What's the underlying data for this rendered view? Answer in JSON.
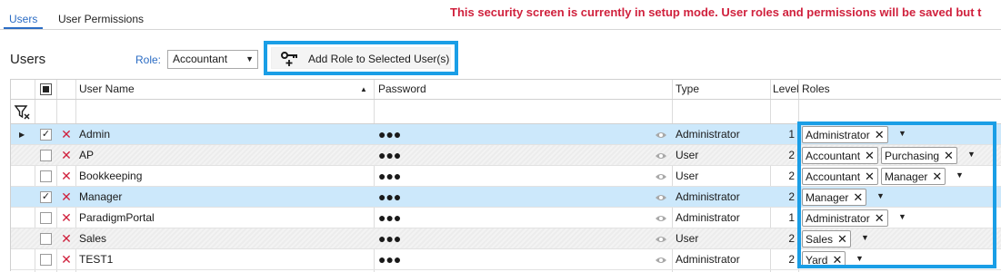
{
  "tabs": [
    {
      "label": "Users",
      "active": true
    },
    {
      "label": "User Permissions",
      "active": false
    }
  ],
  "warning": "This security screen is currently in setup mode. User roles and permissions will be saved but t",
  "toolbar": {
    "title": "Users",
    "role_label": "Role:",
    "role_value": "Accountant",
    "add_role_label": "Add Role to Selected User(s)"
  },
  "grid": {
    "columns": {
      "user_name": "User Name",
      "password": "Password",
      "type": "Type",
      "level": "Level",
      "roles": "Roles"
    },
    "rows": [
      {
        "checked": true,
        "selected": true,
        "current": true,
        "user": "Admin",
        "password": "●●●",
        "type": "Administrator",
        "level": "1",
        "roles": [
          "Administrator"
        ]
      },
      {
        "checked": false,
        "selected": false,
        "current": false,
        "user": "AP",
        "password": "●●●",
        "type": "User",
        "level": "2",
        "roles": [
          "Accountant",
          "Purchasing"
        ]
      },
      {
        "checked": false,
        "selected": false,
        "current": false,
        "user": "Bookkeeping",
        "password": "●●●",
        "type": "User",
        "level": "2",
        "roles": [
          "Accountant",
          "Manager"
        ]
      },
      {
        "checked": true,
        "selected": true,
        "current": false,
        "user": "Manager",
        "password": "●●●",
        "type": "Administrator",
        "level": "2",
        "roles": [
          "Manager"
        ]
      },
      {
        "checked": false,
        "selected": false,
        "current": false,
        "user": "ParadigmPortal",
        "password": "●●●",
        "type": "Administrator",
        "level": "1",
        "roles": [
          "Administrator"
        ]
      },
      {
        "checked": false,
        "selected": false,
        "current": false,
        "user": "Sales",
        "password": "●●●",
        "type": "User",
        "level": "2",
        "roles": [
          "Sales"
        ]
      },
      {
        "checked": false,
        "selected": false,
        "current": false,
        "user": "TEST1",
        "password": "●●●",
        "type": "Administrator",
        "level": "2",
        "roles": [
          "Yard"
        ]
      }
    ]
  },
  "icons": {
    "add_role": "key-plus-icon",
    "filter": "filter-clear-icon",
    "delete": "delete-x-icon",
    "show_password": "eye-icon"
  },
  "colors": {
    "accent": "#2b6cc4",
    "warning": "#d0213d",
    "highlight": "#1a9ee6",
    "selected_row": "#cce8fb"
  }
}
